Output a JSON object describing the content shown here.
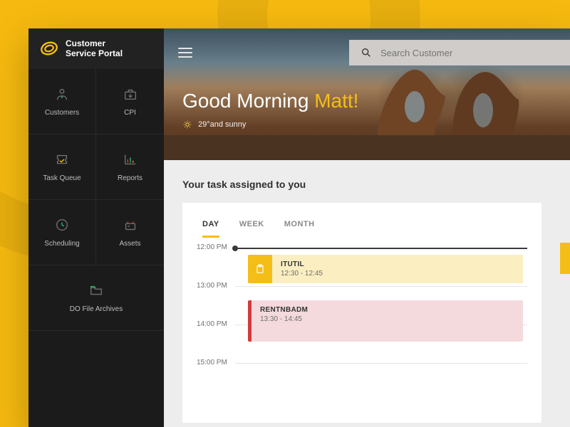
{
  "brand": {
    "line1": "Customer",
    "line2": "Service Portal"
  },
  "sidebar": {
    "items": [
      {
        "label": "Customers",
        "icon": "person-icon"
      },
      {
        "label": "CPI",
        "icon": "inbox-icon"
      },
      {
        "label": "Task Queue",
        "icon": "ticket-icon"
      },
      {
        "label": "Reports",
        "icon": "bar-chart-icon"
      },
      {
        "label": "Scheduling",
        "icon": "clock-icon"
      },
      {
        "label": "Assets",
        "icon": "server-icon"
      },
      {
        "label": "DO File Archives",
        "icon": "folder-icon"
      }
    ]
  },
  "search": {
    "placeholder": "Search Customer"
  },
  "greeting": {
    "prefix": "Good Morning ",
    "name": "Matt!",
    "weather": "29°and sunny"
  },
  "section": {
    "title": "Your task assigned to you"
  },
  "tabs": [
    {
      "label": "DAY",
      "active": true
    },
    {
      "label": "WEEK",
      "active": false
    },
    {
      "label": "MONTH",
      "active": false
    }
  ],
  "timeline": {
    "slots": [
      "12:00 PM",
      "13:00 PM",
      "14:00 PM",
      "15:00 PM"
    ],
    "events": [
      {
        "title": "ITUTIL",
        "time": "12:30 - 12:45",
        "color": "amber"
      },
      {
        "title": "RENTNBADM",
        "time": "13:30 - 14:45",
        "color": "rose"
      }
    ]
  },
  "colors": {
    "accent": "#f4be17",
    "danger": "#d43a3a"
  }
}
